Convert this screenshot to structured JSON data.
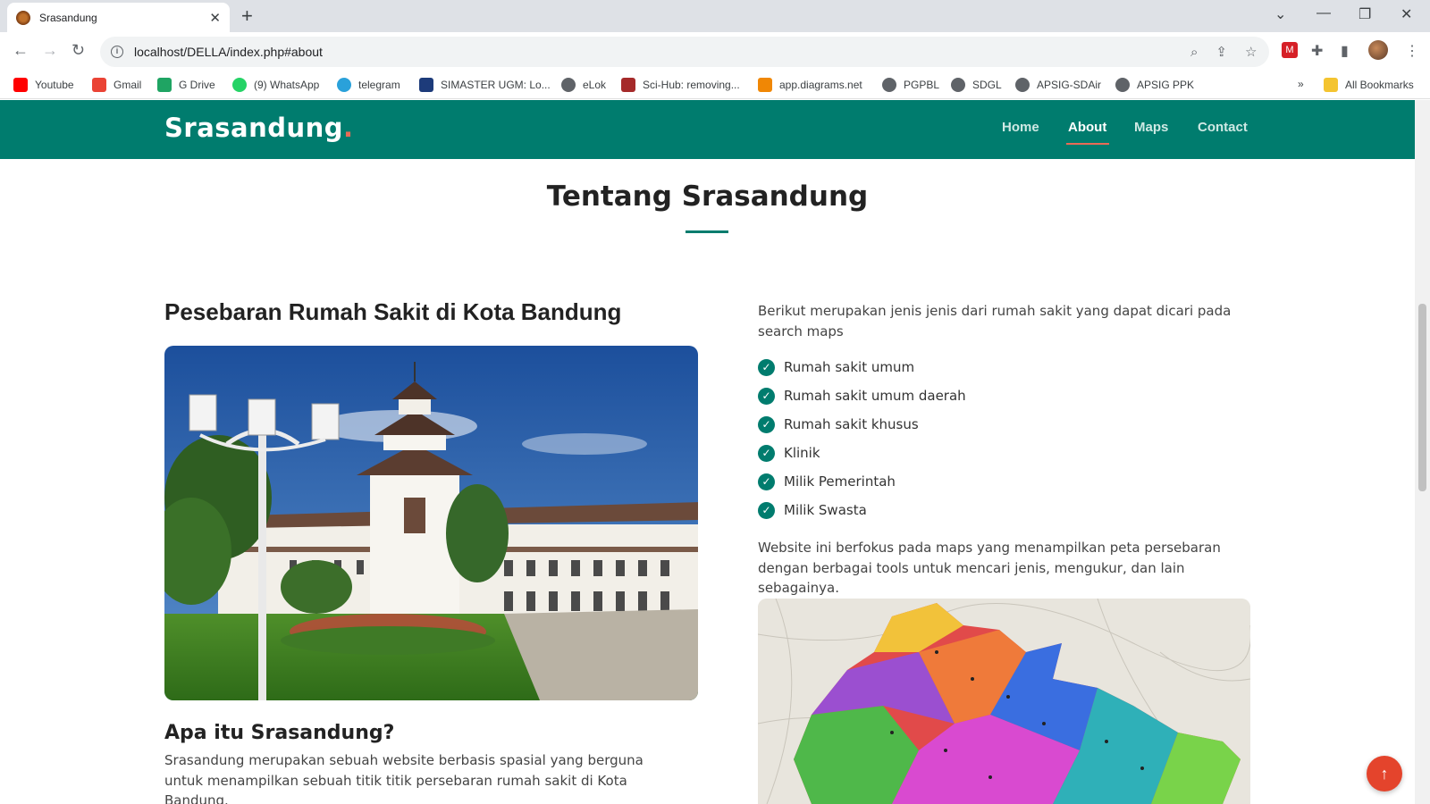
{
  "browser": {
    "tab_title": "Srasandung",
    "tab_close": "✕",
    "new_tab": "+",
    "url": "localhost/DELLA/index.php#about",
    "bookmarks": [
      {
        "label": "Youtube",
        "color": "#ff0000"
      },
      {
        "label": "Gmail",
        "color": "#ea4335"
      },
      {
        "label": "G Drive",
        "color": "#1fa463"
      },
      {
        "label": "(9) WhatsApp",
        "color": "#25d366"
      },
      {
        "label": "telegram",
        "color": "#2aa1da"
      },
      {
        "label": "SIMASTER UGM: Lo...",
        "color": "#1d3b7a"
      },
      {
        "label": "eLok",
        "color": "#5f6368"
      },
      {
        "label": "Sci-Hub: removing...",
        "color": "#a52a2a"
      },
      {
        "label": "app.diagrams.net",
        "color": "#f08705"
      },
      {
        "label": "PGPBL",
        "color": "#5f6368"
      },
      {
        "label": "SDGL",
        "color": "#5f6368"
      },
      {
        "label": "APSIG-SDAir",
        "color": "#5f6368"
      },
      {
        "label": "APSIG PPK",
        "color": "#5f6368"
      }
    ],
    "more_bookmarks": "»",
    "all_bookmarks": "All Bookmarks"
  },
  "site": {
    "logo": "Srasandung",
    "logo_dot": ".",
    "nav": {
      "home": "Home",
      "about": "About",
      "maps": "Maps",
      "contact": "Contact"
    },
    "section_title": "Tentang Srasandung",
    "left": {
      "heading": "Pesebaran Rumah Sakit di Kota Bandung",
      "subheading": "Apa itu Srasandung?",
      "description": "Srasandung merupakan sebuah website berbasis spasial yang berguna untuk menampilkan sebuah titik titik persebaran rumah sakit di Kota Bandung."
    },
    "right": {
      "intro": "Berikut merupakan jenis jenis dari rumah sakit yang dapat dicari pada search maps",
      "items": [
        "Rumah sakit umum",
        "Rumah sakit umum daerah",
        "Rumah sakit khusus",
        "Klinik",
        "Milik Pemerintah",
        "Milik Swasta"
      ],
      "focus": "Website ini berfokus pada maps yang menampilkan peta persebaran dengan berbagai tools untuk mencari jenis, mengukur, dan lain sebagainya."
    },
    "back_to_top": "↑"
  },
  "colors": {
    "brand": "#007c6e",
    "accent": "#e96b56",
    "back_to_top": "#e4442c"
  }
}
